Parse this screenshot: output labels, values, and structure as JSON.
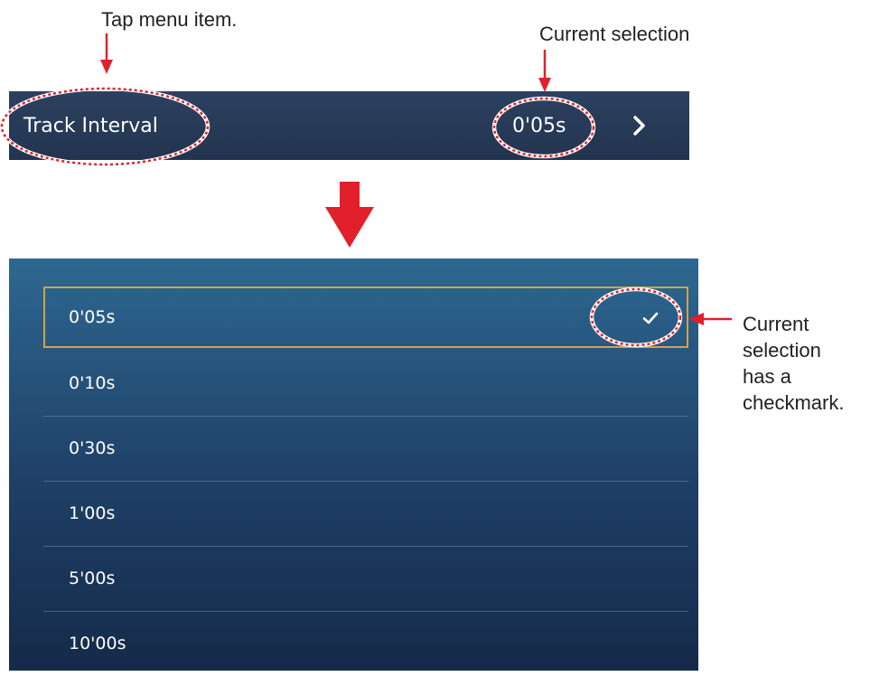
{
  "callouts": {
    "tap_menu_item": "Tap menu item.",
    "current_selection": "Current selection",
    "checkmark_line1": "Current",
    "checkmark_line2": "selection",
    "checkmark_line3": "has a",
    "checkmark_line4": "checkmark."
  },
  "menu_row": {
    "label": "Track Interval",
    "value": "0'05s",
    "chevron_icon": "chevron-right-icon"
  },
  "options": [
    {
      "label": "0'05s",
      "selected": true
    },
    {
      "label": "0'10s",
      "selected": false
    },
    {
      "label": "0'30s",
      "selected": false
    },
    {
      "label": "1'00s",
      "selected": false
    },
    {
      "label": "5'00s",
      "selected": false
    },
    {
      "label": "10'00s",
      "selected": false
    }
  ],
  "colors": {
    "annotation_red": "#e2202b",
    "selection_border": "#d4a24a",
    "menu_bg": "#22344f",
    "panel_top": "#2d6891",
    "panel_bottom": "#152a4a"
  }
}
